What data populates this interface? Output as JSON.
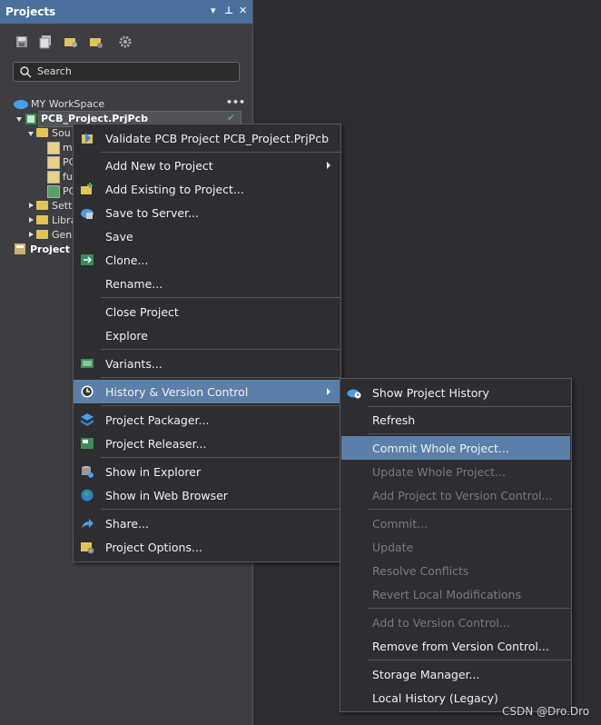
{
  "panel": {
    "title": "Projects",
    "search_placeholder": "Search",
    "controls": [
      "▾",
      "⊥",
      "✕"
    ]
  },
  "tree": {
    "workspace": "MY WorkSpace",
    "workspace_more": "•••",
    "project": "PCB_Project.PrjPcb",
    "source_folder": "Sou",
    "files": [
      "m",
      "PC",
      "fu",
      "PC"
    ],
    "settings": "Setti",
    "libraries": "Libra",
    "generated": "Gen",
    "project_group": "Project G"
  },
  "context_menu": {
    "items": [
      {
        "label": "Validate PCB Project PCB_Project.PrjPcb",
        "icon": "validate-icon"
      },
      {
        "label": "Add New to Project",
        "submenu": true
      },
      {
        "label": "Add Existing to Project...",
        "icon": "add-existing-icon"
      },
      {
        "label": "Save to Server...",
        "icon": "cloud-save-icon"
      },
      {
        "label": "Save"
      },
      {
        "label": "Clone...",
        "icon": "clone-icon"
      },
      {
        "label": "Rename..."
      },
      {
        "label": "Close Project"
      },
      {
        "label": "Explore"
      },
      {
        "label": "Variants...",
        "icon": "variants-icon"
      },
      {
        "label": "History & Version Control",
        "icon": "history-icon",
        "submenu": true,
        "highlighted": true
      },
      {
        "label": "Project Packager...",
        "icon": "packager-icon"
      },
      {
        "label": "Project Releaser...",
        "icon": "releaser-icon"
      },
      {
        "label": "Show in Explorer",
        "icon": "explorer-icon"
      },
      {
        "label": "Show in Web Browser",
        "icon": "web-browser-icon"
      },
      {
        "label": "Share...",
        "icon": "share-icon"
      },
      {
        "label": "Project Options...",
        "icon": "options-icon"
      }
    ]
  },
  "submenu": {
    "items": [
      {
        "label": "Show Project History",
        "icon": "cloud-history-icon"
      },
      {
        "label": "Refresh"
      },
      {
        "label": "Commit Whole Project...",
        "highlighted": true
      },
      {
        "label": "Update Whole Project...",
        "disabled": true
      },
      {
        "label": "Add Project to Version Control...",
        "disabled": true
      },
      {
        "label": "Commit...",
        "disabled": true
      },
      {
        "label": "Update",
        "disabled": true
      },
      {
        "label": "Resolve Conflicts",
        "disabled": true
      },
      {
        "label": "Revert Local Modifications",
        "disabled": true
      },
      {
        "label": "Add to Version Control...",
        "disabled": true
      },
      {
        "label": "Remove from Version Control..."
      },
      {
        "label": "Storage Manager..."
      },
      {
        "label": "Local History (Legacy)"
      }
    ]
  },
  "watermark": "CSDN @Dro.Dro",
  "colors": {
    "highlight": "#5b7fa8",
    "panel_title": "#4a6f9c",
    "menu_bg": "#2e2e31",
    "disabled_text": "#7b7b7b"
  }
}
